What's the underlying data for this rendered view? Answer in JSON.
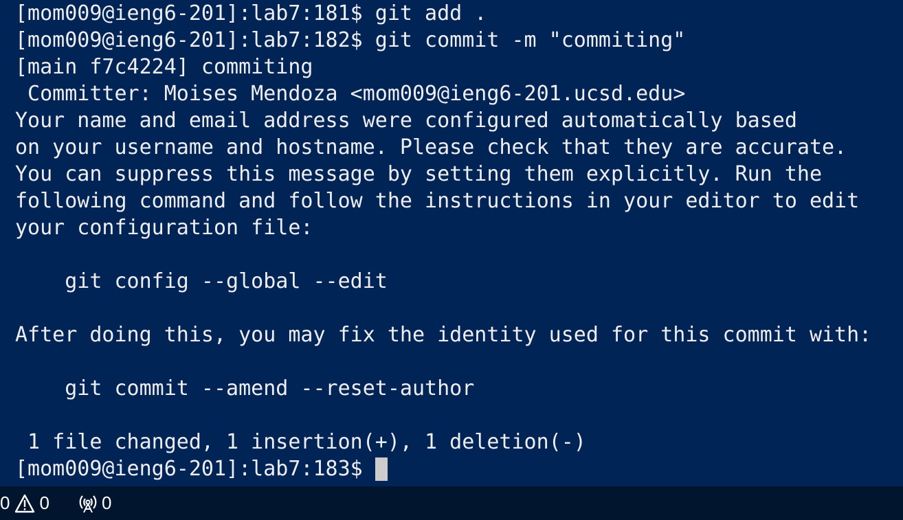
{
  "terminal": {
    "lines": [
      "[mom009@ieng6-201]:lab7:181$ git add .",
      "[mom009@ieng6-201]:lab7:182$ git commit -m \"commiting\"",
      "[main f7c4224] commiting",
      " Committer: Moises Mendoza <mom009@ieng6-201.ucsd.edu>",
      "Your name and email address were configured automatically based",
      "on your username and hostname. Please check that they are accurate.",
      "You can suppress this message by setting them explicitly. Run the",
      "following command and follow the instructions in your editor to edit",
      "your configuration file:",
      "",
      "    git config --global --edit",
      "",
      "After doing this, you may fix the identity used for this commit with:",
      "",
      "    git commit --amend --reset-author",
      "",
      " 1 file changed, 1 insertion(+), 1 deletion(-)"
    ],
    "prompt": "[mom009@ieng6-201]:lab7:183$"
  },
  "statusbar": {
    "errors_count": "0",
    "warnings_count": "0",
    "ports_count": "0",
    "icons": {
      "warnings": "warning-icon",
      "ports": "broadcast-icon"
    }
  },
  "colors": {
    "terminal_background": "#012456",
    "terminal_text": "#eeeeee",
    "statusbar_background": "#02152e"
  }
}
